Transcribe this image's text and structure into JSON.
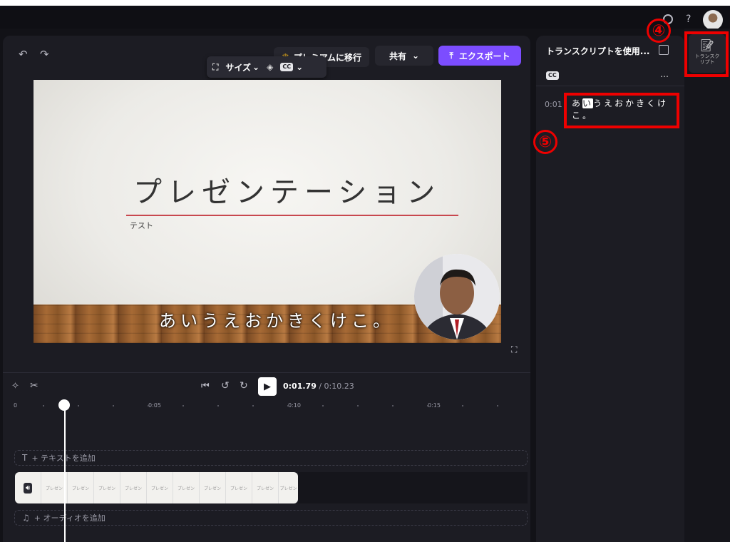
{
  "topbar": {
    "help": "?"
  },
  "toolbar": {
    "undo_icon": "undo-icon",
    "redo_icon": "redo-icon",
    "premium_label": "プレミアムに移行",
    "share_label": "共有",
    "export_label": "エクスポート"
  },
  "floatbar": {
    "size_label": "サイズ",
    "cc_label": "CC"
  },
  "slide": {
    "title": "プレゼンテーション",
    "subtitle": "テスト",
    "caption": "あいうえおかきくけこ。"
  },
  "playback": {
    "current_time": "0:01.79",
    "total_time": " / 0:10.23"
  },
  "ruler": {
    "t0": "0",
    "t5": "0:05",
    "t10": "0:10",
    "t15": "0:15"
  },
  "tracks": {
    "add_text": "+ テキストを追加",
    "add_audio": "+ オーディオを追加",
    "clip_frame_text": "プレゼン"
  },
  "transcript": {
    "title": "トランスクリプトを使用...",
    "cc_label": "CC",
    "more": "…",
    "time": "0:01",
    "text_part1": "あ",
    "text_highlight": "い",
    "text_part2": "うえおかきくけこ。"
  },
  "sidebar": {
    "transcript_label": "トランスクリプト"
  },
  "annotations": {
    "marker4": "④",
    "marker5": "⑤"
  },
  "colors": {
    "accent": "#7c4dff",
    "highlight_red": "#e00000",
    "premium_gold": "#f2b51c"
  }
}
